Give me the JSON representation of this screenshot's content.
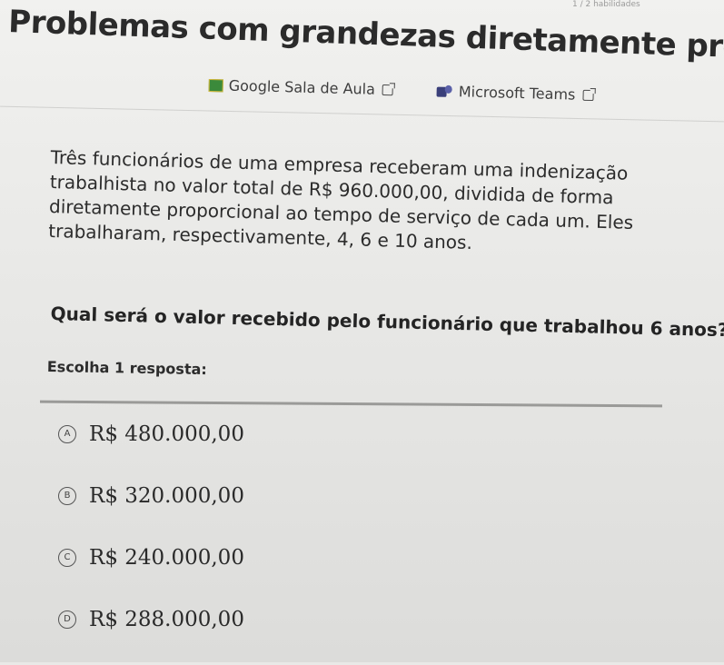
{
  "header": {
    "skills_text": "1 / 2 habilidades",
    "title": "Problemas com grandezas diretamente proporcionais"
  },
  "share": {
    "google_classroom": "Google Sala de Aula",
    "microsoft_teams": "Microsoft Teams"
  },
  "problem": {
    "text": "Três funcionários de uma empresa receberam uma indenização trabalhista no valor total de R$ 960.000,00, dividida de forma diretamente proporcional ao tempo de serviço de cada um. Eles trabalharam, respectivamente, 4, 6 e 10 anos."
  },
  "question": {
    "text": "Qual será o valor recebido pelo funcionário que trabalhou 6 anos?"
  },
  "answers": {
    "prompt": "Escolha 1 resposta:",
    "options": [
      {
        "letter": "A",
        "value": "R$ 480.000,00"
      },
      {
        "letter": "B",
        "value": "R$ 320.000,00"
      },
      {
        "letter": "C",
        "value": "R$ 240.000,00"
      },
      {
        "letter": "D",
        "value": "R$ 288.000,00"
      }
    ]
  },
  "colors": {
    "background": "#e9e9e7",
    "text": "#2a2a2a",
    "google_classroom_icon": "#3b8a3b",
    "teams_icon": "#3a3f7a"
  }
}
